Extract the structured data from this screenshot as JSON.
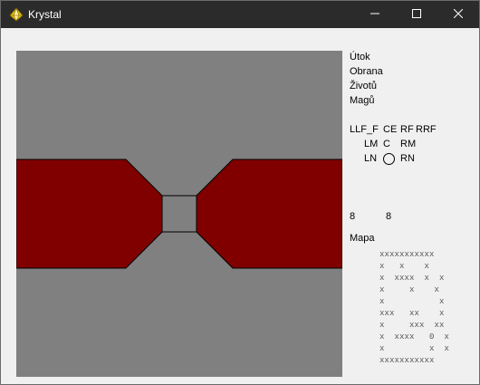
{
  "window": {
    "title": "Krystal",
    "icon": "crystal-icon",
    "controls": [
      "minimize-icon",
      "maximize-icon",
      "close-icon"
    ]
  },
  "stats": {
    "attack_label": "Útok",
    "defense_label": "Obrana",
    "lives_label": "Životů",
    "mages_label": "Magů"
  },
  "neighbors": {
    "row1": [
      "LLF_F",
      "CE",
      "RF",
      "RRF"
    ],
    "row2": [
      "LM",
      "C",
      "RM"
    ],
    "row3": [
      "LN",
      "RN"
    ]
  },
  "counters": {
    "left": "8",
    "right": "8"
  },
  "map": {
    "label": "Mapa",
    "rows": [
      "xxxxxxxxxxx",
      "x   x    x",
      "x  xxxx  x  x",
      "x     x    x",
      "x           x",
      "xxx   xx    x",
      "x     xxx  xx",
      "x  xxxx   0  x",
      "x         x  x",
      "xxxxxxxxxxx"
    ]
  },
  "colors": {
    "floor": "#808080",
    "wall": "#800000",
    "titlebar": "#2b2b2b",
    "background": "#f0f0f0"
  }
}
